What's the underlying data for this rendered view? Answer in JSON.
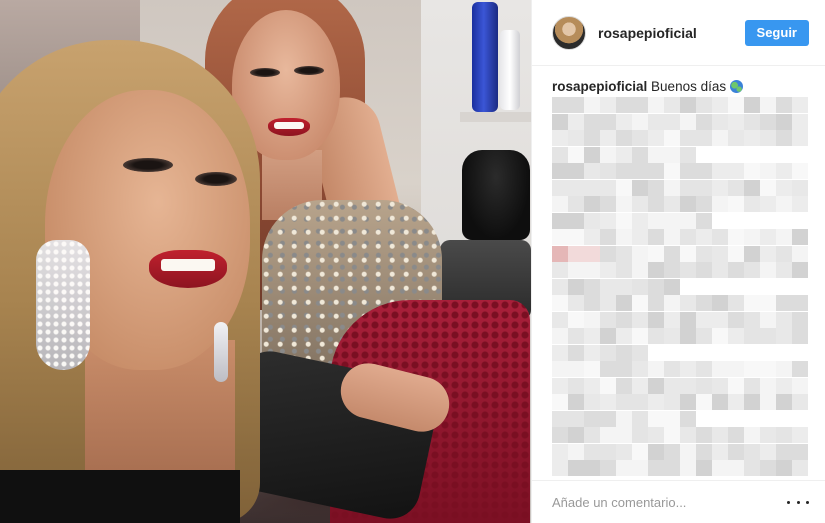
{
  "post": {
    "username": "rosapepioficial",
    "follow_label": "Seguir",
    "caption_username": "rosapepioficial",
    "caption_text": "Buenos días",
    "caption_emoji": "globe-emoji",
    "comment_placeholder": "Añade un comentario...",
    "more_options": "more-options-icon"
  },
  "colors": {
    "follow_button": "#3897f0",
    "text": "#262626",
    "placeholder": "#999999",
    "divider": "#efefef"
  }
}
